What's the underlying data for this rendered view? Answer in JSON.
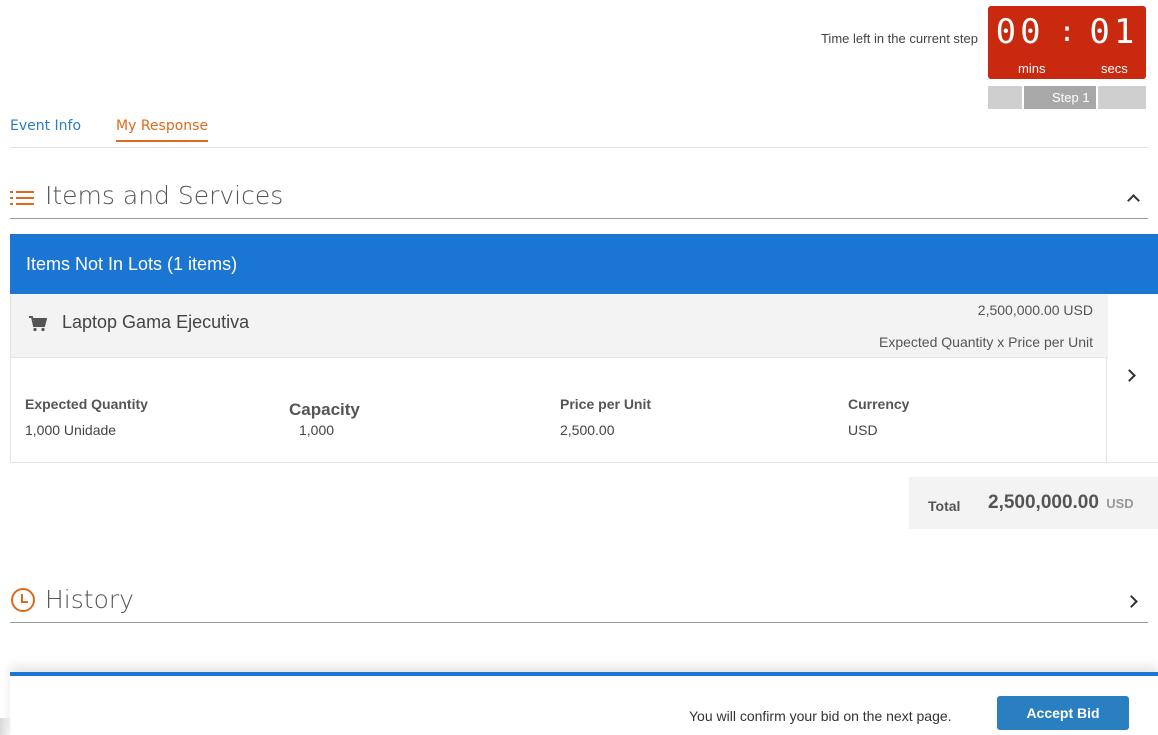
{
  "timer": {
    "label": "Time left in the current step",
    "minutes": "00",
    "colon": ":",
    "seconds": "01",
    "mins_label": "mins",
    "secs_label": "secs",
    "step_label": "Step 1",
    "color": "#c9290f"
  },
  "tabs": [
    {
      "label": "Event Info",
      "active": false
    },
    {
      "label": "My Response",
      "active": true
    }
  ],
  "items_section": {
    "title": "Items and Services",
    "icon": "list-icon",
    "collapse_icon": "chevron-up-icon"
  },
  "lot_header": {
    "title": "Items Not In Lots (1 items)",
    "color": "#1a76d2"
  },
  "item": {
    "icon": "cart-icon",
    "name": "Laptop Gama Ejecutiva",
    "extended_amount": "2,500,000.00 USD",
    "formula": "Expected Quantity x Price per Unit",
    "fields": [
      {
        "label": "Expected Quantity",
        "value": "1,000 Unidade"
      },
      {
        "label": "Capacity",
        "value": "1,000"
      },
      {
        "label": "Price per Unit",
        "value": "2,500.00"
      },
      {
        "label": "Currency",
        "value": "USD"
      }
    ],
    "expand_icon": "chevron-right-icon"
  },
  "total": {
    "label": "Total",
    "value": "2,500,000.00",
    "currency": "USD"
  },
  "history_section": {
    "title": "History",
    "icon": "clock-icon",
    "expand_icon": "chevron-right-icon"
  },
  "footer": {
    "message": "You will confirm your bid on the next page.",
    "accept_label": "Accept Bid"
  }
}
